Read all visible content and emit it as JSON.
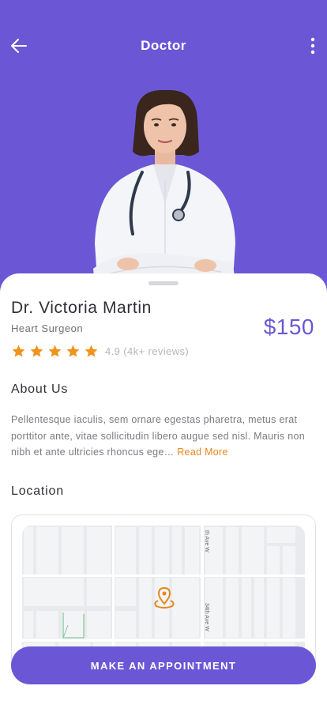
{
  "header": {
    "title": "Doctor",
    "back_icon": "arrow-left-icon",
    "more_icon": "more-vertical-icon",
    "background_color": "#6b57d6"
  },
  "doctor": {
    "name": "Dr. Victoria Martin",
    "specialty": "Heart Surgeon",
    "price": "$150",
    "rating": 4.9,
    "rating_text": "4.9 (4k+ reviews)",
    "stars": 5
  },
  "about": {
    "title": "About Us",
    "text": "Pellentesque iaculis, sem ornare egestas pharetra, metus erat porttitor ante, vitae sollicitudin libero augue sed nisl. Mauris non nibh et ante ultricies rhoncus ege…",
    "read_more": "Read More"
  },
  "location": {
    "title": "Location",
    "street_1": "th Ave W",
    "street_2": "34th Ave W",
    "pin_icon": "map-pin-icon"
  },
  "cta": {
    "label": "MAKE AN APPOINTMENT"
  },
  "colors": {
    "accent": "#6b57d6",
    "star": "#f0931b",
    "read_more": "#e7871a"
  }
}
